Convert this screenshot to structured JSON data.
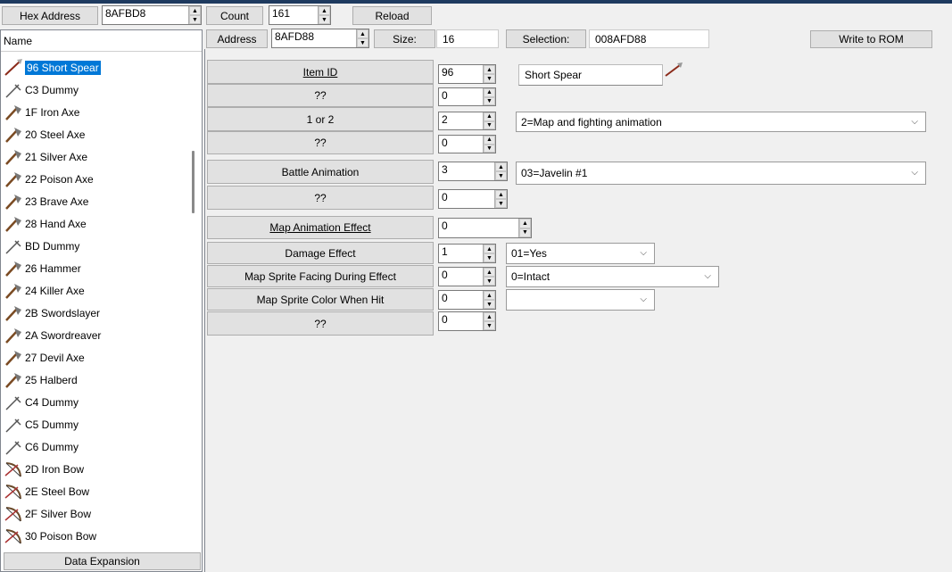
{
  "toolbar": {
    "hex_address_label": "Hex Address",
    "hex_address_value": "8AFBD8",
    "count_label": "Count",
    "count_value": "161",
    "reload_label": "Reload"
  },
  "subbar": {
    "address_label": "Address",
    "address_value": "8AFD88",
    "size_label": "Size:",
    "size_value": "16",
    "selection_label": "Selection:",
    "selection_value": "008AFD88",
    "write_label": "Write to ROM"
  },
  "sidebar": {
    "header": "Name",
    "items": [
      {
        "label": "96 Short Spear",
        "icon": "spear-icon",
        "selected": true
      },
      {
        "label": "C3 Dummy",
        "icon": "dummy-icon"
      },
      {
        "label": "1F Iron Axe",
        "icon": "axe-icon"
      },
      {
        "label": "20 Steel Axe",
        "icon": "axe-icon"
      },
      {
        "label": "21 Silver Axe",
        "icon": "axe-icon"
      },
      {
        "label": "22 Poison Axe",
        "icon": "axe-icon"
      },
      {
        "label": "23 Brave Axe",
        "icon": "axe-icon"
      },
      {
        "label": "28 Hand Axe",
        "icon": "axe-icon"
      },
      {
        "label": "BD Dummy",
        "icon": "dummy-icon"
      },
      {
        "label": "26 Hammer",
        "icon": "axe-icon"
      },
      {
        "label": "24 Killer Axe",
        "icon": "axe-icon"
      },
      {
        "label": "2B Swordslayer",
        "icon": "axe-icon"
      },
      {
        "label": "2A Swordreaver",
        "icon": "axe-icon"
      },
      {
        "label": "27 Devil Axe",
        "icon": "axe-icon"
      },
      {
        "label": "25 Halberd",
        "icon": "axe-icon"
      },
      {
        "label": "C4 Dummy",
        "icon": "dummy-icon"
      },
      {
        "label": "C5 Dummy",
        "icon": "dummy-icon"
      },
      {
        "label": "C6 Dummy",
        "icon": "dummy-icon"
      },
      {
        "label": "2D Iron Bow",
        "icon": "bow-icon"
      },
      {
        "label": "2E Steel Bow",
        "icon": "bow-icon"
      },
      {
        "label": "2F Silver Bow",
        "icon": "bow-icon"
      },
      {
        "label": "30 Poison Bow",
        "icon": "bow-icon"
      }
    ],
    "expansion_label": "Data Expansion"
  },
  "form": {
    "item_id_label": "Item ID",
    "item_id_value": "96",
    "item_name": "Short Spear",
    "unk1_label": "??",
    "unk1_value": "0",
    "one_or_two_label": "1 or 2",
    "one_or_two_value": "2",
    "one_or_two_option": "2=Map and fighting animation",
    "unk2_label": "??",
    "unk2_value": "0",
    "battle_anim_label": "Battle Animation",
    "battle_anim_value": "3",
    "battle_anim_option": "03=Javelin #1",
    "unk3_label": "??",
    "unk3_value": "0",
    "map_anim_label": "Map Animation Effect",
    "map_anim_value": "0",
    "damage_label": "Damage Effect",
    "damage_value": "1",
    "damage_option": "01=Yes",
    "facing_label": "Map Sprite Facing During Effect",
    "facing_value": "0",
    "facing_option": "0=Intact",
    "color_label": "Map Sprite Color When Hit",
    "color_value": "0",
    "color_option": "",
    "unk4_label": "??",
    "unk4_value": "0"
  }
}
